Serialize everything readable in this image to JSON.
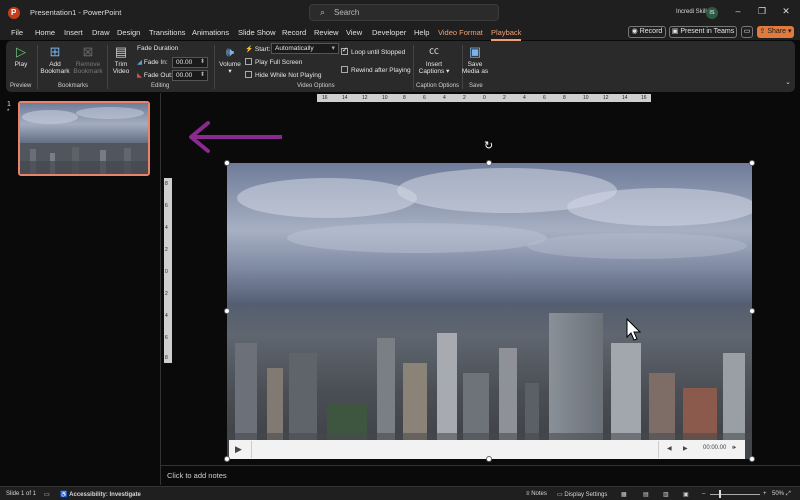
{
  "titlebar": {
    "doc_title": "Presentation1 - PowerPoint",
    "search_placeholder": "Search",
    "user_name": "Incredi Skill",
    "user_initials": "IS"
  },
  "tabs": [
    "File",
    "Home",
    "Insert",
    "Draw",
    "Design",
    "Transitions",
    "Animations",
    "Slide Show",
    "Record",
    "Review",
    "View",
    "Developer",
    "Help",
    "Video Format",
    "Playback"
  ],
  "active_tab": "Playback",
  "topright": {
    "record": "Record",
    "present": "Present in Teams",
    "share": "Share"
  },
  "ribbon": {
    "preview": {
      "play": "Play",
      "label": "Preview"
    },
    "bookmarks": {
      "add": "Add Bookmark",
      "remove": "Remove Bookmark",
      "label": "Bookmarks"
    },
    "editing": {
      "trim": "Trim Video",
      "fade_duration": "Fade Duration",
      "fade_in": "Fade In:",
      "fade_in_value": "00.00",
      "fade_out": "Fade Out:",
      "fade_out_value": "00.00",
      "label": "Editing"
    },
    "video_options": {
      "volume": "Volume",
      "start": "Start:",
      "start_value": "Automatically",
      "play_full_screen": "Play Full Screen",
      "hide_while_not_playing": "Hide While Not Playing",
      "loop_until_stopped": "Loop until Stopped",
      "loop_checked": true,
      "rewind_after_playing": "Rewind after Playing",
      "label": "Video Options"
    },
    "caption_options": {
      "insert_captions": "Insert Captions",
      "label": "Caption Options"
    },
    "save": {
      "save_media_as": "Save Media as",
      "label": "Save"
    }
  },
  "ruler": {
    "horizontal": [
      "16",
      "14",
      "12",
      "10",
      "8",
      "6",
      "4",
      "2",
      "0",
      "2",
      "4",
      "6",
      "8",
      "10",
      "12",
      "14",
      "16"
    ],
    "vertical": [
      "8",
      "6",
      "4",
      "2",
      "0",
      "2",
      "4",
      "6",
      "8"
    ]
  },
  "slide_pane": {
    "slide_number": "1",
    "slide_marker": "*"
  },
  "video_controls": {
    "time": "00:00.00"
  },
  "notes_placeholder": "Click to add notes",
  "statusbar": {
    "slide_info": "Slide 1 of 1",
    "accessibility": "Accessibility: Investigate",
    "notes": "Notes",
    "display_settings": "Display Settings",
    "zoom": "50%"
  },
  "colors": {
    "accent": "#f0a078",
    "share": "#e07a3f",
    "thumbnail_border": "#e8846a",
    "arrow": "#8a2a8f"
  }
}
